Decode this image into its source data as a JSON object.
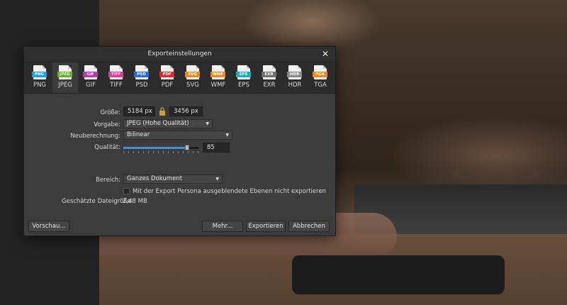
{
  "dialog": {
    "title": "Exporteinstellungen",
    "close_glyph": "✕"
  },
  "formats": [
    {
      "tag": "PNG",
      "label": "PNG",
      "color": "#1ea0e0",
      "icon": "png-file-icon"
    },
    {
      "tag": "JPEG",
      "label": "JPEG",
      "color": "#6ab030",
      "icon": "jpeg-file-icon"
    },
    {
      "tag": "GIF",
      "label": "GIF",
      "color": "#b03cb0",
      "icon": "gif-file-icon"
    },
    {
      "tag": "TIFF",
      "label": "TIFF",
      "color": "#e03c96",
      "icon": "tiff-file-icon"
    },
    {
      "tag": "PSD",
      "label": "PSD",
      "color": "#2a6ad8",
      "icon": "psd-file-icon"
    },
    {
      "tag": "PDF",
      "label": "PDF",
      "color": "#e0282c",
      "icon": "pdf-file-icon"
    },
    {
      "tag": "SVG",
      "label": "SVG",
      "color": "#f08a18",
      "icon": "svg-file-icon"
    },
    {
      "tag": "WMF",
      "label": "WMF",
      "color": "#f08a18",
      "icon": "wmf-file-icon"
    },
    {
      "tag": "EPS",
      "label": "EPS",
      "color": "#18b0c0",
      "icon": "eps-file-icon"
    },
    {
      "tag": "EXR",
      "label": "EXR",
      "color": "#707070",
      "icon": "exr-file-icon"
    },
    {
      "tag": "HDR",
      "label": "HDR",
      "color": "#8a8a8a",
      "icon": "hdr-file-icon"
    },
    {
      "tag": "TGA",
      "label": "TGA",
      "color": "#f08a18",
      "icon": "tga-file-icon"
    }
  ],
  "active_format": "JPEG",
  "form": {
    "size_label": "Größe:",
    "width_value": "5184 px",
    "height_value": "3456 px",
    "preset_label": "Vorgabe:",
    "preset_value": "JPEG (Hohe Qualität)",
    "resample_label": "Neuberechnung:",
    "resample_value": "Bilinear",
    "quality_label": "Qualität:",
    "quality_value": "85",
    "quality_fraction": 0.85,
    "area_label": "Bereich:",
    "area_value": "Ganzes Dokument",
    "hidden_layers_checkbox_label": "Mit der Export Persona ausgeblendete Ebenen nicht exportieren",
    "hidden_layers_checked": false,
    "filesize_label": "Geschätzte Dateigröße:",
    "filesize_value": "2,48 MB"
  },
  "buttons": {
    "preview": "Vorschau...",
    "more": "Mehr...",
    "export": "Exportieren",
    "cancel": "Abbrechen"
  }
}
